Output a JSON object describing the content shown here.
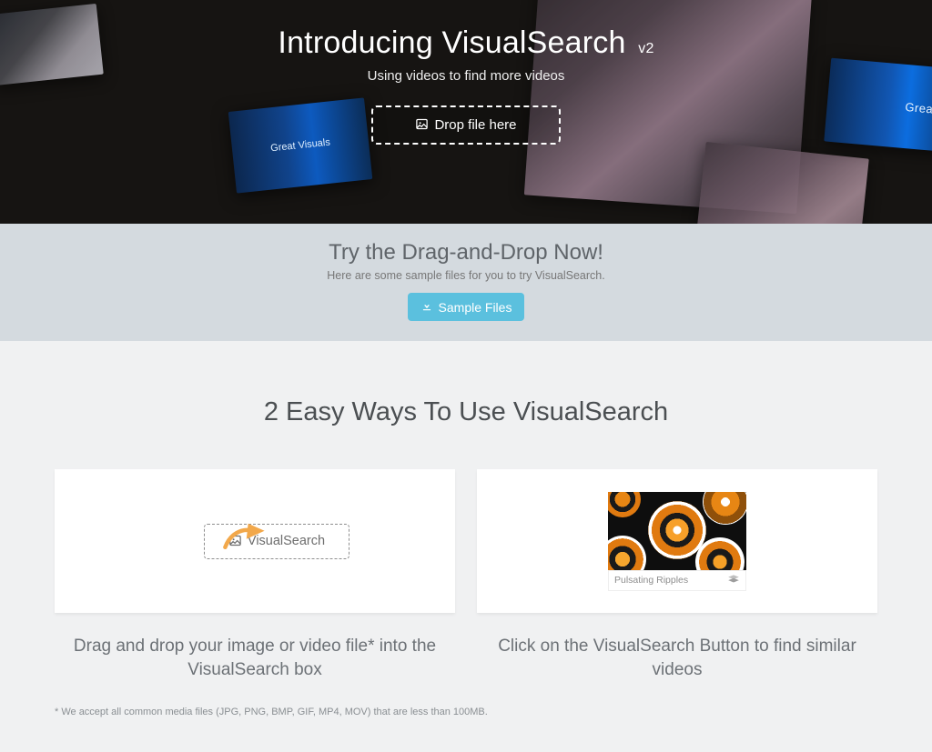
{
  "hero": {
    "title_main": "Introducing VisualSearch",
    "version": "v2",
    "subtitle": "Using videos to find more videos",
    "drop_label": "Drop file here",
    "floating_label_a": "Great Visuals",
    "floating_label_b": "Great Vis"
  },
  "sample": {
    "title": "Try the Drag-and-Drop Now!",
    "subtitle": "Here are some sample files for you to try VisualSearch.",
    "button": "Sample Files"
  },
  "ways": {
    "heading": "2 Easy Ways To Use VisualSearch",
    "card1_drop_label": "VisualSearch",
    "card1_caption": "Drag and drop your image or video file* into the VisualSearch box",
    "card2_thumb_label": "Pulsating Ripples",
    "card2_caption": "Click on the VisualSearch Button to find similar videos",
    "footnote": "* We accept all common media files (JPG, PNG, BMP, GIF, MP4, MOV) that are less than 100MB."
  }
}
